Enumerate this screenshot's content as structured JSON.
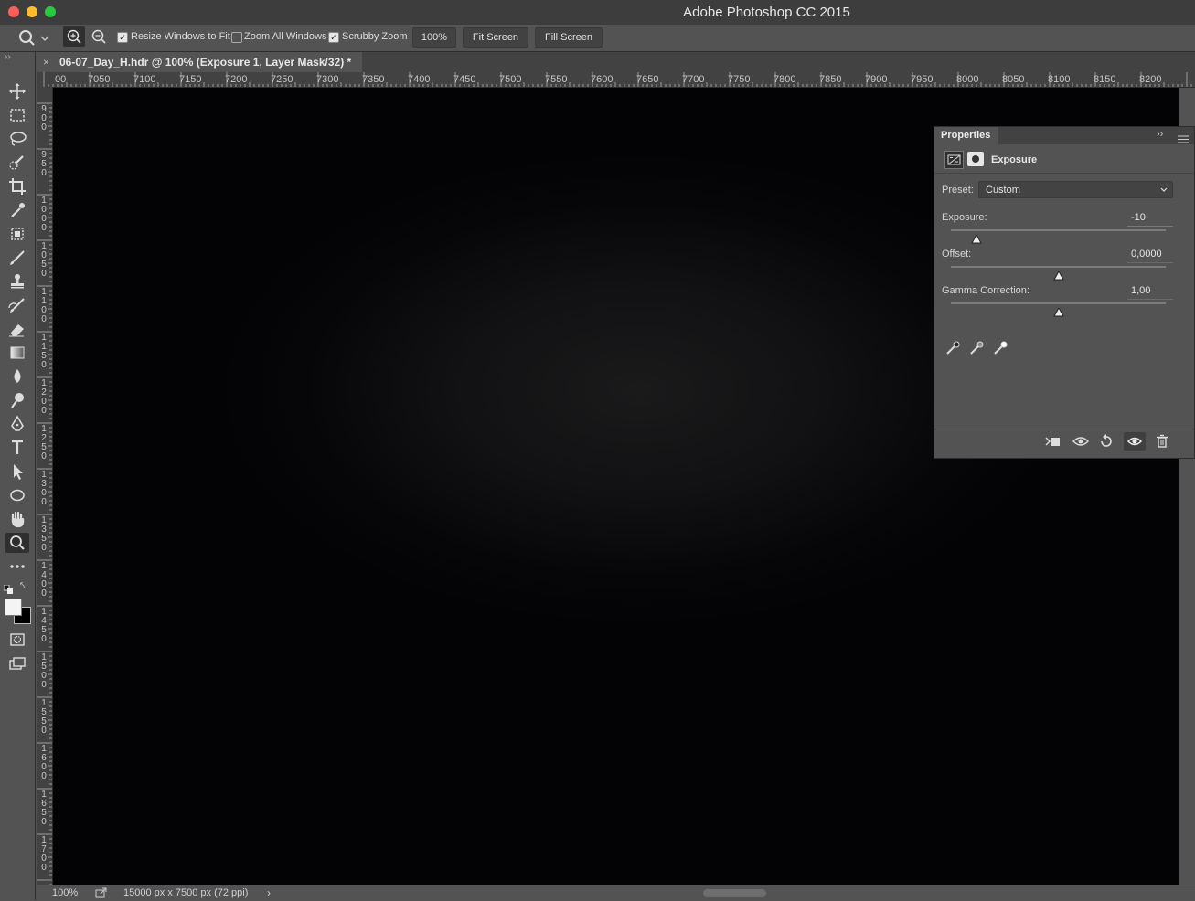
{
  "window": {
    "title": "Adobe Photoshop CC 2015",
    "buttons": {
      "close_color": "#fd5f57",
      "minimize_color": "#febb2e",
      "zoom_color": "#28c840"
    }
  },
  "options_bar": {
    "resize_windows_label": "Resize Windows to Fit",
    "resize_windows_checked": true,
    "zoom_all_label": "Zoom All Windows",
    "zoom_all_checked": false,
    "scrubby_label": "Scrubby Zoom",
    "scrubby_checked": true,
    "zoom_value": "100%",
    "fit_screen_label": "Fit Screen",
    "fill_screen_label": "Fill Screen"
  },
  "document": {
    "tab_label": "06-07_Day_H.hdr @ 100% (Exposure 1, Layer Mask/32) *",
    "close_glyph": "×"
  },
  "ruler": {
    "top_labels": [
      "00",
      "7050",
      "7100",
      "7150",
      "7200",
      "7250",
      "7300",
      "7350",
      "7400",
      "7450",
      "7500",
      "7550",
      "7600",
      "7650",
      "7700",
      "7750",
      "7800",
      "7850",
      "7900",
      "7950",
      "8000",
      "8050",
      "8100",
      "8150",
      "8200"
    ],
    "left_labels": [
      "900",
      "950",
      "1000",
      "1050",
      "1100",
      "1150",
      "1200",
      "1250",
      "1300",
      "1350",
      "1400",
      "1450",
      "1500",
      "1550",
      "1600",
      "1650",
      "1700"
    ]
  },
  "status": {
    "zoom": "100%",
    "info": "15000 px x 7500 px (72 ppi)",
    "arrow": "›"
  },
  "properties": {
    "title": "Properties",
    "adjustment_name": "Exposure",
    "preset_label": "Preset:",
    "preset_value": "Custom",
    "exposure_label": "Exposure:",
    "exposure_value": "-10",
    "exposure_slider_fraction": 0.12,
    "offset_label": "Offset:",
    "offset_value": "0,0000",
    "offset_slider_fraction": 0.5,
    "gamma_label": "Gamma Correction:",
    "gamma_value": "1,00",
    "gamma_slider_fraction": 0.5
  },
  "tools": [
    "move-tool-icon",
    "marquee-tool-icon",
    "lasso-tool-icon",
    "quick-select-tool-icon",
    "crop-tool-icon",
    "eyedropper-tool-icon",
    "spot-heal-tool-icon",
    "brush-tool-icon",
    "stamp-tool-icon",
    "history-brush-tool-icon",
    "eraser-tool-icon",
    "gradient-tool-icon",
    "blur-tool-icon",
    "dodge-tool-icon",
    "pen-tool-icon",
    "type-tool-icon",
    "path-select-tool-icon",
    "ellipse-tool-icon",
    "hand-tool-icon",
    "zoom-tool-icon",
    "more-tools-icon"
  ]
}
